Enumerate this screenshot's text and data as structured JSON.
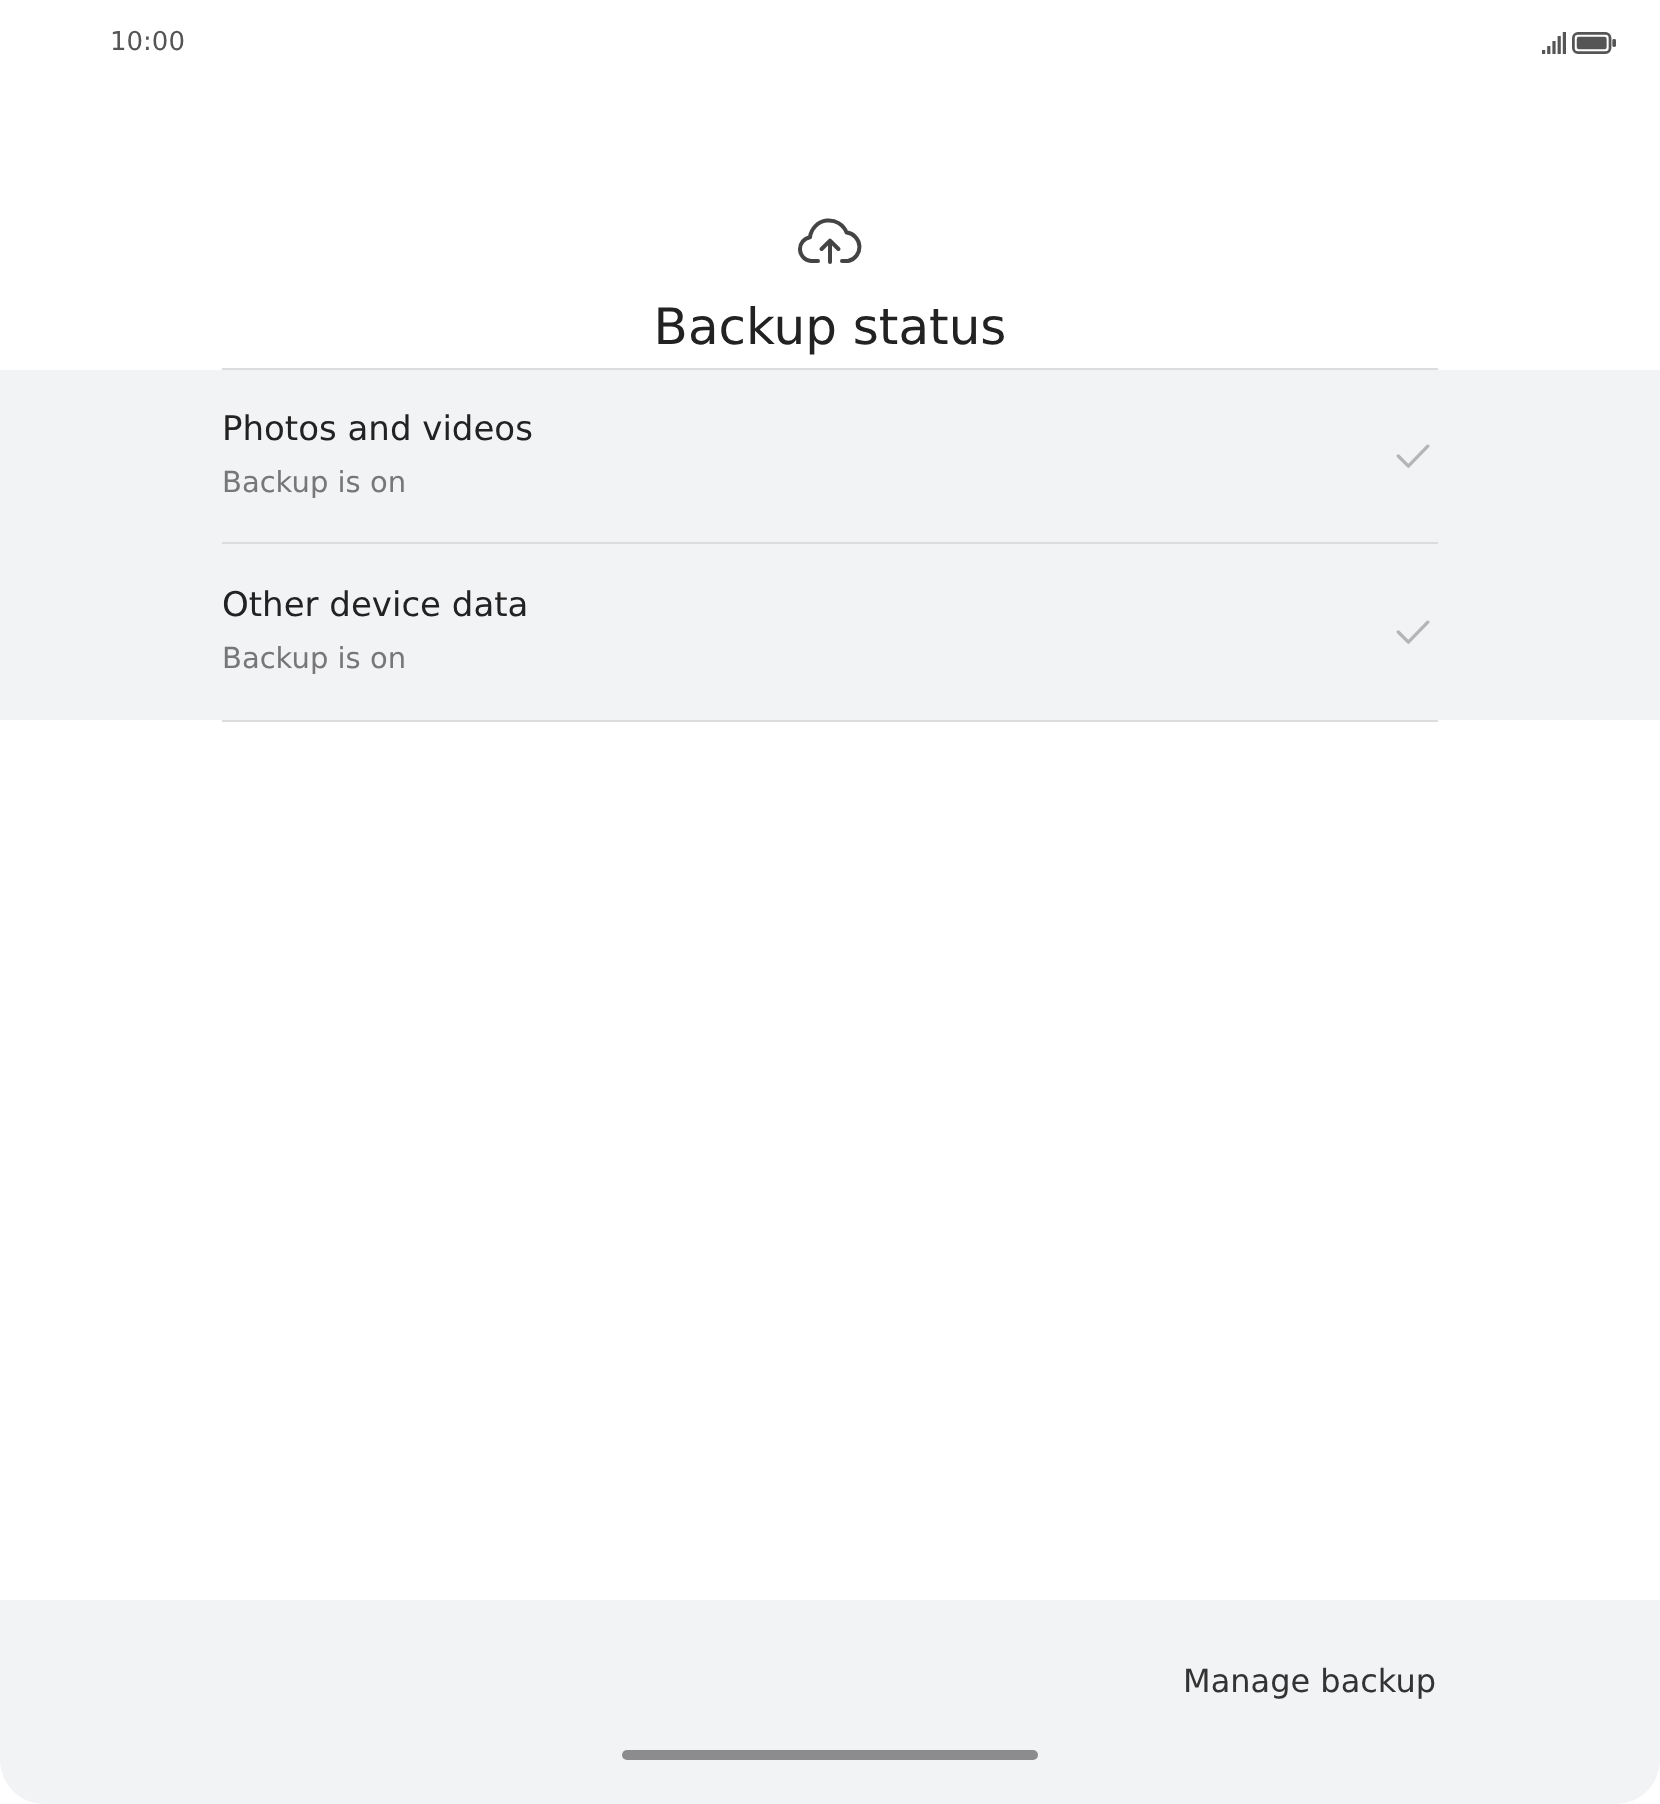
{
  "status_bar": {
    "time": "10:00"
  },
  "header": {
    "title": "Backup status"
  },
  "items": [
    {
      "title": "Photos and videos",
      "subtitle": "Backup is on",
      "checked": true
    },
    {
      "title": "Other device data",
      "subtitle": "Backup is on",
      "checked": true
    }
  ],
  "footer": {
    "button": "Manage backup"
  }
}
